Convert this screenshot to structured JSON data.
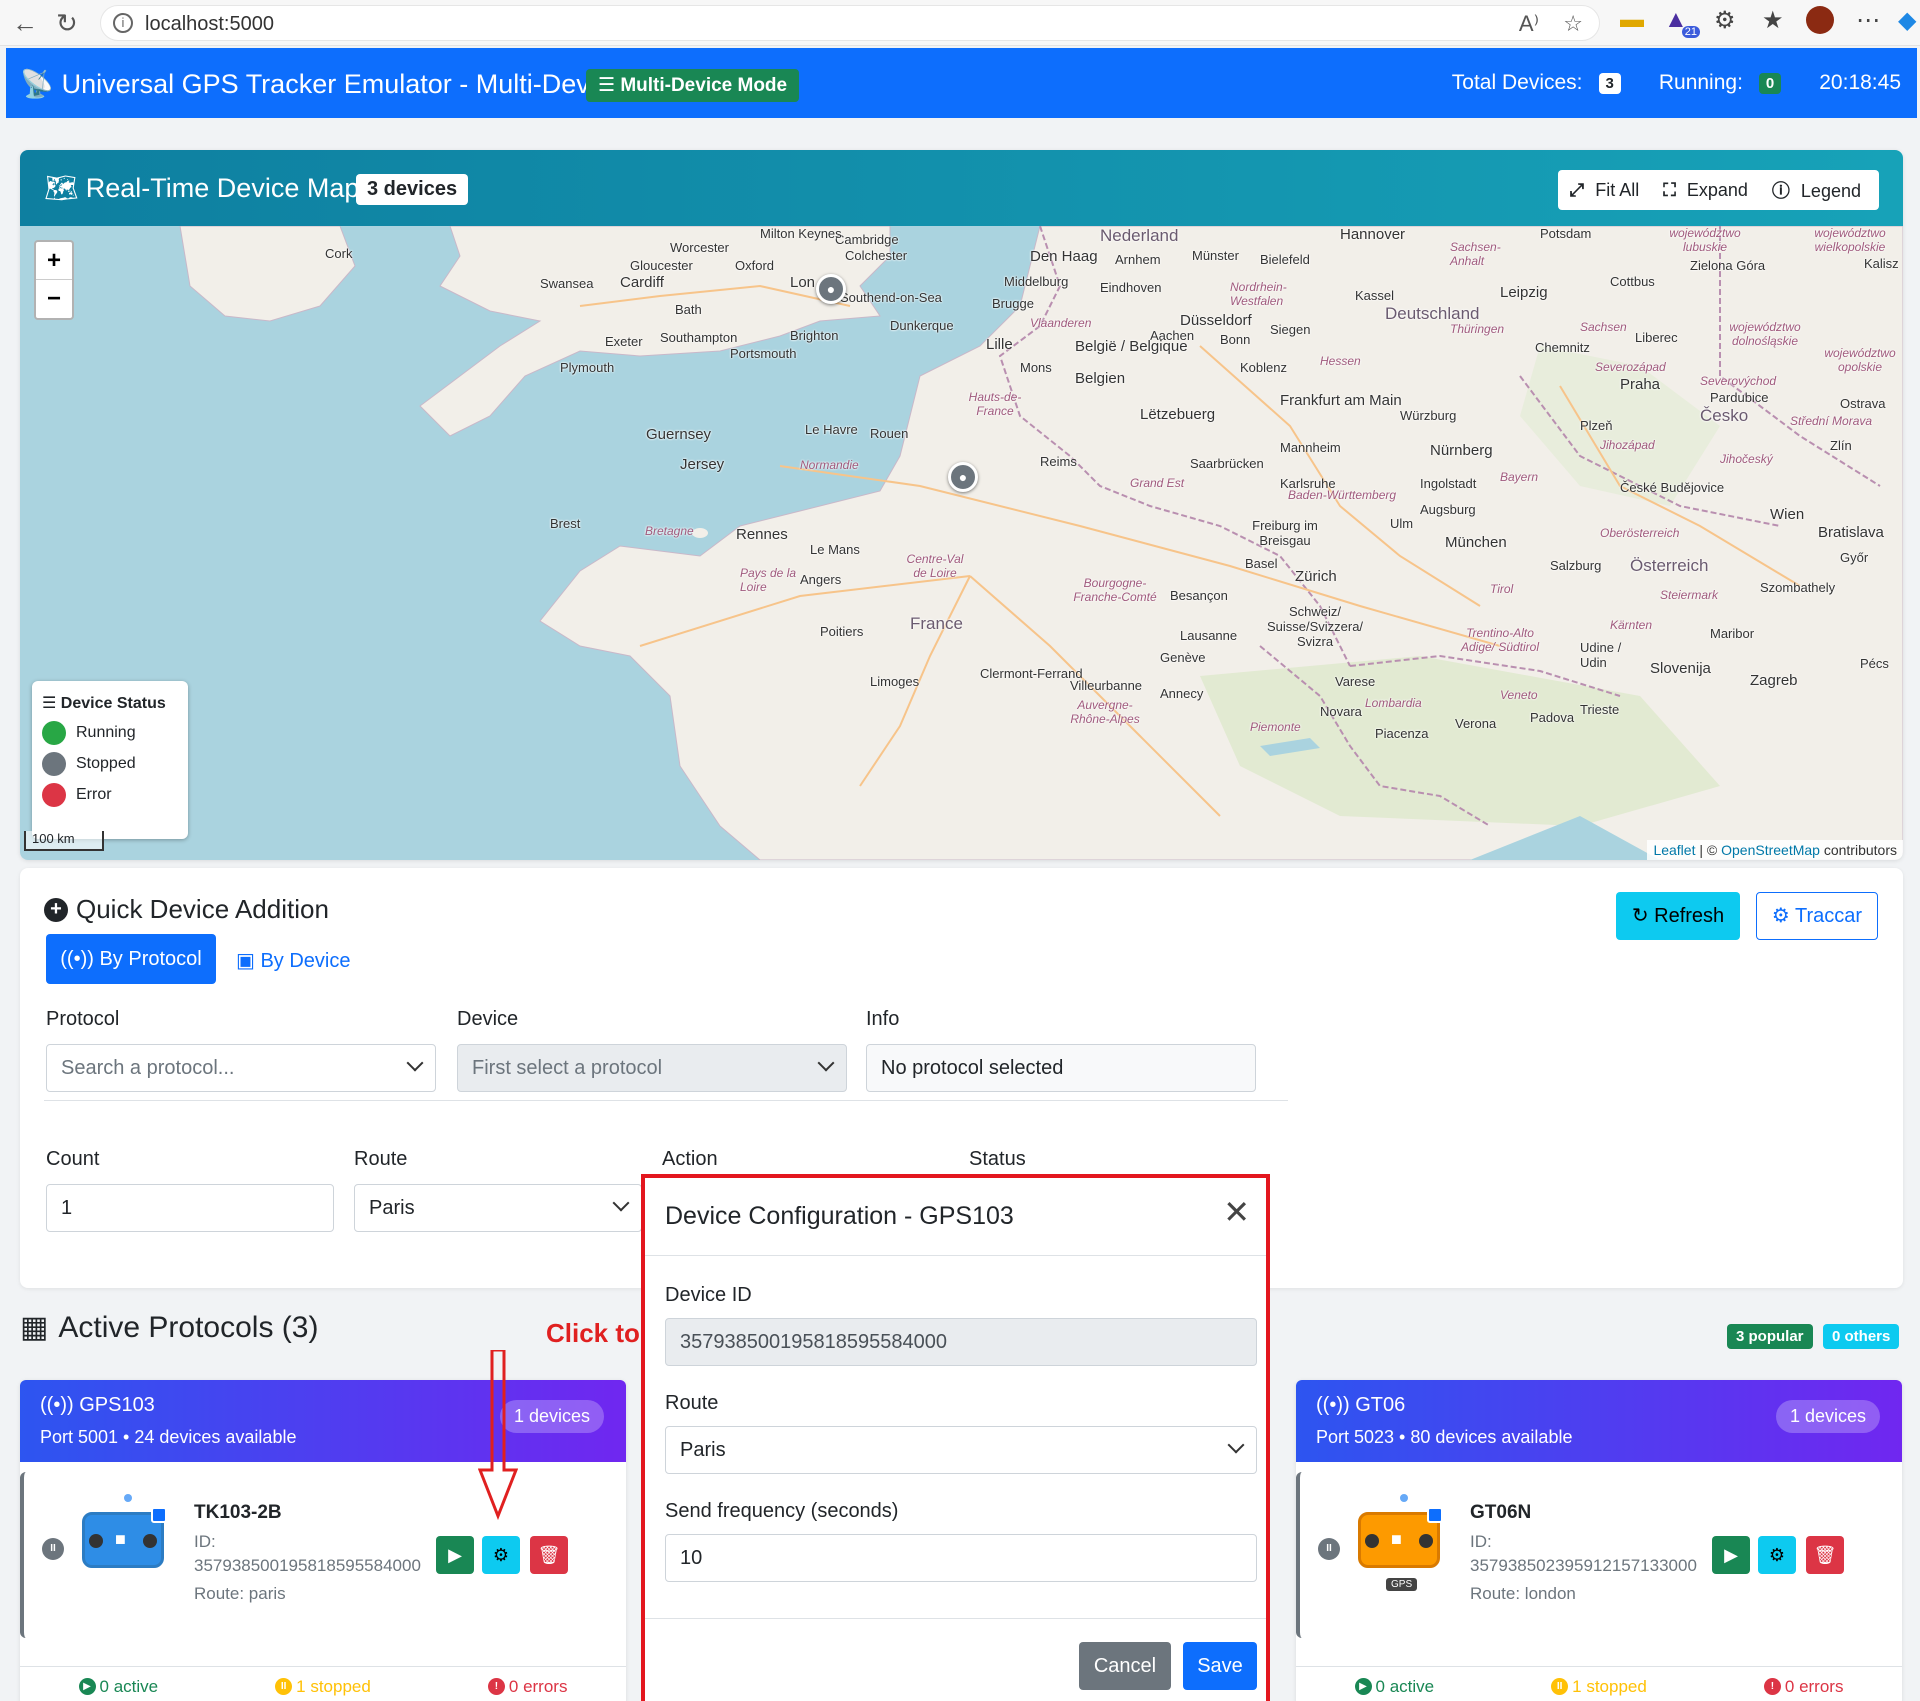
{
  "browser": {
    "url": "localhost:5000",
    "extension_badge": "21"
  },
  "header": {
    "title": "Universal GPS Tracker Emulator - Multi-Device",
    "mode_badge": "Multi-Device Mode",
    "total_label": "Total Devices:",
    "total_value": "3",
    "running_label": "Running:",
    "running_value": "0",
    "clock": "20:18:45"
  },
  "map": {
    "title": "Real-Time Device Map",
    "device_count": "3 devices",
    "fit_all": "Fit All",
    "expand": "Expand",
    "legend": "Legend",
    "zoom_in": "+",
    "zoom_out": "−",
    "legend_title": "Device Status",
    "legend_items": [
      {
        "label": "Running",
        "color": "#28a745"
      },
      {
        "label": "Stopped",
        "color": "#6c757d"
      },
      {
        "label": "Error",
        "color": "#dc3545"
      }
    ],
    "scale": "100 km",
    "attribution_leaflet": "Leaflet",
    "attribution_sep": " | © ",
    "attribution_osm": "OpenStreetMap",
    "attribution_tail": " contributors",
    "cities": {
      "cork": "Cork",
      "worcester": "Worcester",
      "gloucester": "Gloucester",
      "oxford": "Oxford",
      "swansea": "Swansea",
      "cardiff": "Cardiff",
      "bath": "Bath",
      "cambridge": "Cambridge",
      "colchester": "Colchester",
      "milton_keynes": "Milton Keynes",
      "london": "Lon",
      "southend": "Southend-on-Sea",
      "exeter": "Exeter",
      "southampton": "Southampton",
      "brighton": "Brighton",
      "portsmouth": "Portsmouth",
      "plymouth": "Plymouth",
      "guernsey": "Guernsey",
      "jersey": "Jersey",
      "lehavre": "Le Havre",
      "rouen": "Rouen",
      "dunkerque": "Dunkerque",
      "lille": "Lille",
      "brugge": "Brugge",
      "middelburg": "Middelburg",
      "denhaag": "Den Haag",
      "arnhem": "Arnhem",
      "nederland": "Nederland",
      "eindhoven": "Eindhoven",
      "munster": "Münster",
      "bielefeld": "Bielefeld",
      "hannover": "Hannover",
      "potsdam": "Potsdam",
      "dusseldorf": "Düsseldorf",
      "aachen": "Aachen",
      "bonn": "Bonn",
      "siegen": "Siegen",
      "kassel": "Kassel",
      "deutschland": "Deutschland",
      "leipzig": "Leipzig",
      "cottbus": "Cottbus",
      "zielona": "Zielona Góra",
      "chemnitz": "Chemnitz",
      "liberec": "Liberec",
      "praha": "Praha",
      "pardubice": "Pardubice",
      "cesko": "Česko",
      "ostrava": "Ostrava",
      "belgie": "België / Belgique",
      "belgien": "Belgien",
      "mons": "Mons",
      "koblenz": "Koblenz",
      "frankfurt": "Frankfurt am Main",
      "wurzburg": "Würzburg",
      "letzebuerg": "Lëtzebuerg",
      "mannheim": "Mannheim",
      "nurnberg": "Nürnberg",
      "plzen": "Plzeň",
      "reims": "Reims",
      "saarbrucken": "Saarbrücken",
      "karlsruhe": "Karlsruhe",
      "ingolstadt": "Ingolstadt",
      "augsburg": "Augsburg",
      "ceske": "České Budějovice",
      "brest": "Brest",
      "rennes": "Rennes",
      "lemans": "Le Mans",
      "angers": "Angers",
      "france": "France",
      "poitiers": "Poitiers",
      "limoges": "Limoges",
      "clermont": "Clermont-Ferrand",
      "villeurbanne": "Villeurbanne",
      "annecy": "Annecy",
      "geneve": "Genève",
      "lausanne": "Lausanne",
      "besancon": "Besançon",
      "basel": "Basel",
      "zurich": "Zürich",
      "schweiz": "Schweiz/ Suisse/Svizzera/ Svizra",
      "freiburg": "Freiburg im Breisgau",
      "ulm": "Ulm",
      "munchen": "München",
      "salzburg": "Salzburg",
      "osterreich": "Österreich",
      "wien": "Wien",
      "bratislava": "Bratislava",
      "gyor": "Győr",
      "szombathely": "Szombathely",
      "maribor": "Maribor",
      "slovenija": "Slovenija",
      "zagreb": "Zagreb",
      "udine": "Udine / Udin",
      "trieste": "Trieste",
      "padova": "Padova",
      "verona": "Verona",
      "novara": "Novara",
      "varese": "Varese",
      "piacenza": "Piacenza",
      "zlin": "Zlín",
      "kalisz": "Kalisz",
      "pecs": "Pécs"
    },
    "regions": {
      "normandie": "Normandie",
      "bretagne": "Bretagne",
      "pays": "Pays de la Loire",
      "centre": "Centre-Val de Loire",
      "hauts": "Hauts-de-France",
      "grandest": "Grand Est",
      "bourgogne": "Bourgogne-Franche-Comté",
      "auvergne": "Auvergne-Rhône-Alpes",
      "vlaanderen": "Vlaanderen",
      "nrw": "Nordrhein-Westfalen",
      "hessen": "Hessen",
      "thuringen": "Thüringen",
      "sachsen": "Sachsen",
      "sachsen_anhalt": "Sachsen-Anhalt",
      "bw": "Baden-Württemberg",
      "bayern": "Bayern",
      "tirol": "Tirol",
      "oberosterreich": "Oberösterreich",
      "steiermark": "Steiermark",
      "karnten": "Kärnten",
      "trentino": "Trentino-Alto Adige/ Südtirol",
      "veneto": "Veneto",
      "lombardia": "Lombardia",
      "piemonte": "Piemonte",
      "jihocesky": "Jihočeský",
      "jihozapad": "Jihozápad",
      "wojew": "województwo dolnośląskie",
      "lubuskie": "województwo lubuskie",
      "opolskie": "województwo opolskie",
      "wielkopolskie": "województwo wielkopolskie",
      "severovychod": "Severovýchod",
      "stredni": "Střední Morava",
      "severozapad": "Severozápad"
    }
  },
  "quick_add": {
    "title": "Quick Device Addition",
    "tab_protocol": "By Protocol",
    "tab_device": "By Device",
    "refresh": "Refresh",
    "traccar": "Traccar",
    "protocol_label": "Protocol",
    "protocol_placeholder": "Search a protocol...",
    "device_label": "Device",
    "device_placeholder": "First select a protocol",
    "info_label": "Info",
    "info_value": "No protocol selected",
    "count_label": "Count",
    "count_value": "1",
    "route_label": "Route",
    "route_value": "Paris",
    "action_label": "Action",
    "status_label": "Status"
  },
  "active_protocols": {
    "title": "Active Protocols (3)",
    "annotation": "Click to",
    "popular_badge": "3 popular",
    "others_badge": "0 others",
    "cards": [
      {
        "name": "GPS103",
        "port_line": "Port 5001 • 24 devices available",
        "devices_badge": "1 devices",
        "device_name": "TK103-2B",
        "id_label": "ID:",
        "id_value": "357938500195818595584000",
        "route": "Route: paris",
        "active": "0 active",
        "stopped": "1 stopped",
        "errors": "0 errors"
      },
      {
        "name": "GT06",
        "port_line": "Port 5023 • 80 devices available",
        "devices_badge": "1 devices",
        "device_name": "GT06N",
        "id_label": "ID:",
        "id_value": "357938502395912157133000",
        "route": "Route: london",
        "gps_tag": "GPS",
        "active": "0 active",
        "stopped": "1 stopped",
        "errors": "0 errors"
      }
    ]
  },
  "modal": {
    "title": "Device Configuration - GPS103",
    "device_id_label": "Device ID",
    "device_id_value": "357938500195818595584000",
    "route_label": "Route",
    "route_value": "Paris",
    "freq_label": "Send frequency (seconds)",
    "freq_value": "10",
    "cancel": "Cancel",
    "save": "Save"
  },
  "colors": {
    "primary": "#0d6efd",
    "success": "#198754",
    "info": "#0dcaf0",
    "danger": "#dc3545",
    "warning": "#ffc107",
    "map_header": "#17a2b8",
    "protocol_gradient_start": "#2d55f0",
    "protocol_gradient_end": "#7027f0",
    "highlight": "#e3161e"
  }
}
